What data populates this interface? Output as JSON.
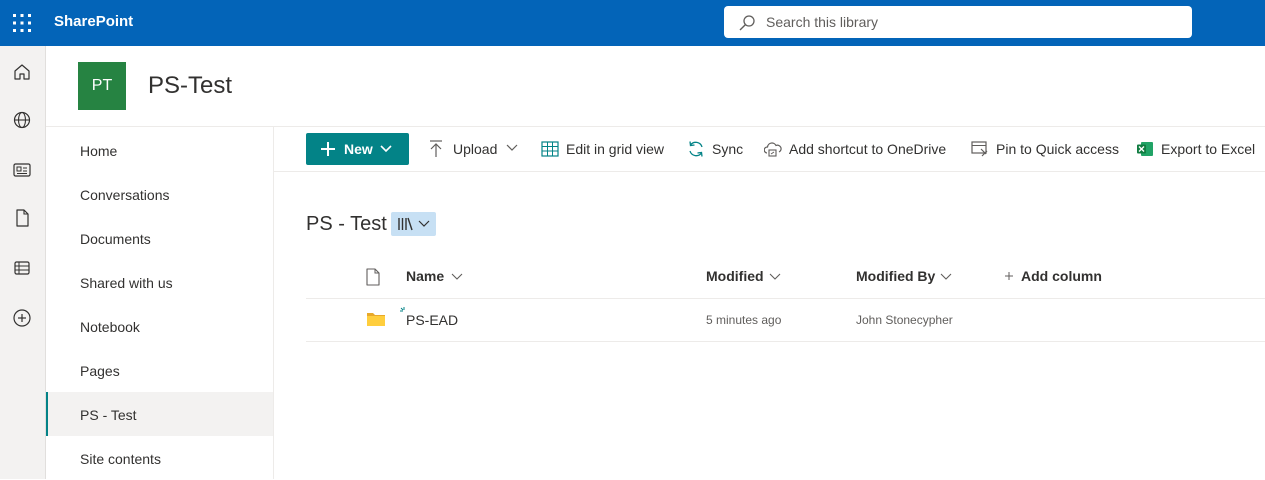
{
  "suite": {
    "brand": "SharePoint",
    "search_placeholder": "Search this library"
  },
  "site": {
    "logo_initials": "PT",
    "logo_color": "#268342",
    "title": "PS-Test"
  },
  "appbar_icons": [
    "home-icon",
    "globe-icon",
    "news-icon",
    "file-icon",
    "list-icon",
    "create-icon"
  ],
  "leftnav": {
    "items": [
      {
        "label": "Home"
      },
      {
        "label": "Conversations"
      },
      {
        "label": "Documents"
      },
      {
        "label": "Shared with us"
      },
      {
        "label": "Notebook"
      },
      {
        "label": "Pages"
      },
      {
        "label": "PS - Test",
        "selected": true
      },
      {
        "label": "Site contents"
      }
    ]
  },
  "commands": {
    "new_label": "New",
    "upload_label": "Upload",
    "grid_label": "Edit in grid view",
    "sync_label": "Sync",
    "shortcut_label": "Add shortcut to OneDrive",
    "pin_label": "Pin to Quick access",
    "export_label": "Export to Excel"
  },
  "library": {
    "title": "PS - Test",
    "columns": {
      "name": "Name",
      "modified": "Modified",
      "modified_by": "Modified By",
      "add_column": "Add column"
    },
    "rows": [
      {
        "name": "PS-EAD",
        "modified": "5 minutes ago",
        "modified_by": "John Stonecypher",
        "type": "folder",
        "is_new": true
      }
    ]
  },
  "colors": {
    "suite_bar": "#0364b8",
    "accent": "#038387",
    "folder": "#ffce3d"
  }
}
